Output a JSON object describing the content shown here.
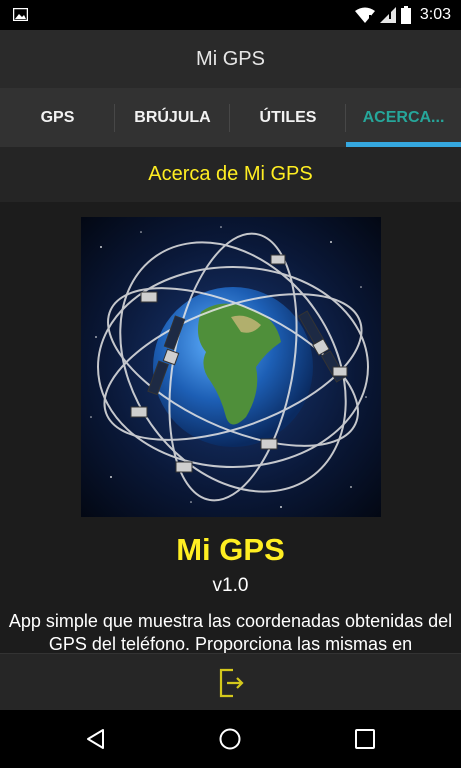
{
  "status_bar": {
    "time": "3:03",
    "icons": [
      "gallery-icon",
      "wifi-icon",
      "signal-icon",
      "battery-icon"
    ]
  },
  "app_bar": {
    "title": "Mi GPS"
  },
  "tabs": [
    {
      "label": "GPS",
      "active": false
    },
    {
      "label": "BRÚJULA",
      "active": false
    },
    {
      "label": "ÚTILES",
      "active": false
    },
    {
      "label": "ACERCA...",
      "active": true
    }
  ],
  "section": {
    "title": "Acerca de Mi GPS"
  },
  "about": {
    "app_name": "Mi GPS",
    "version": "v1.0",
    "description": "App simple que muestra las coordenadas obtenidas del GPS del teléfono. Proporciona las mismas en"
  },
  "bottom_bar": {
    "icon": "exit-icon"
  },
  "nav_bar": {
    "icons": [
      "back-icon",
      "home-icon",
      "recents-icon"
    ]
  },
  "colors": {
    "accent_yellow": "#ffee22",
    "tab_active": "#26a69a",
    "tab_indicator": "#35a8e0"
  }
}
